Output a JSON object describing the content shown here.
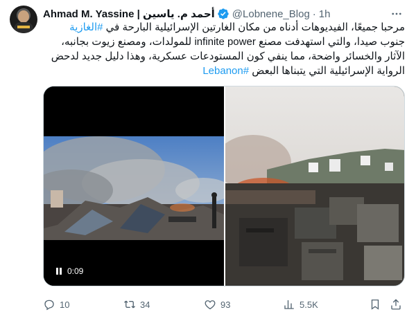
{
  "author": {
    "name": "Ahmad M. Yassine | أحمد م. ياسين",
    "handle": "@Lobnene_Blog",
    "separator": "·",
    "time": "1h"
  },
  "tweet_text": {
    "line1_text": "مرحبا جميعًا، الفيديوهات أدناه من مكان الغارتين الإسرائيلية البارحة في ",
    "line1_tag": "#الغازية",
    "line2": "جنوب صيدا، والتي استهدفت مصنع infinite power للمولدات، ومصنع زيوت بجانبه،",
    "line3": "الآثار والخسائر واضحة، مما ينفي كون المستودعات عسكرية، وهذا دليل جديد لدحض",
    "line4_text": "الرواية الإسرائيلية التي يتبناها البعض ",
    "line4_tag": "#Lebanon"
  },
  "media": {
    "video_time": "0:09"
  },
  "actions": {
    "replies": "10",
    "retweets": "34",
    "likes": "93",
    "views": "5.5K"
  },
  "colors": {
    "accent": "#1d9bf0",
    "secondary_text": "#536471",
    "primary_text": "#0f1419",
    "border": "#cfd9de"
  },
  "icons": [
    "more-icon",
    "verified-icon",
    "play-pause-icon",
    "reply-icon",
    "retweet-icon",
    "like-icon",
    "views-icon",
    "bookmark-icon",
    "share-icon"
  ]
}
